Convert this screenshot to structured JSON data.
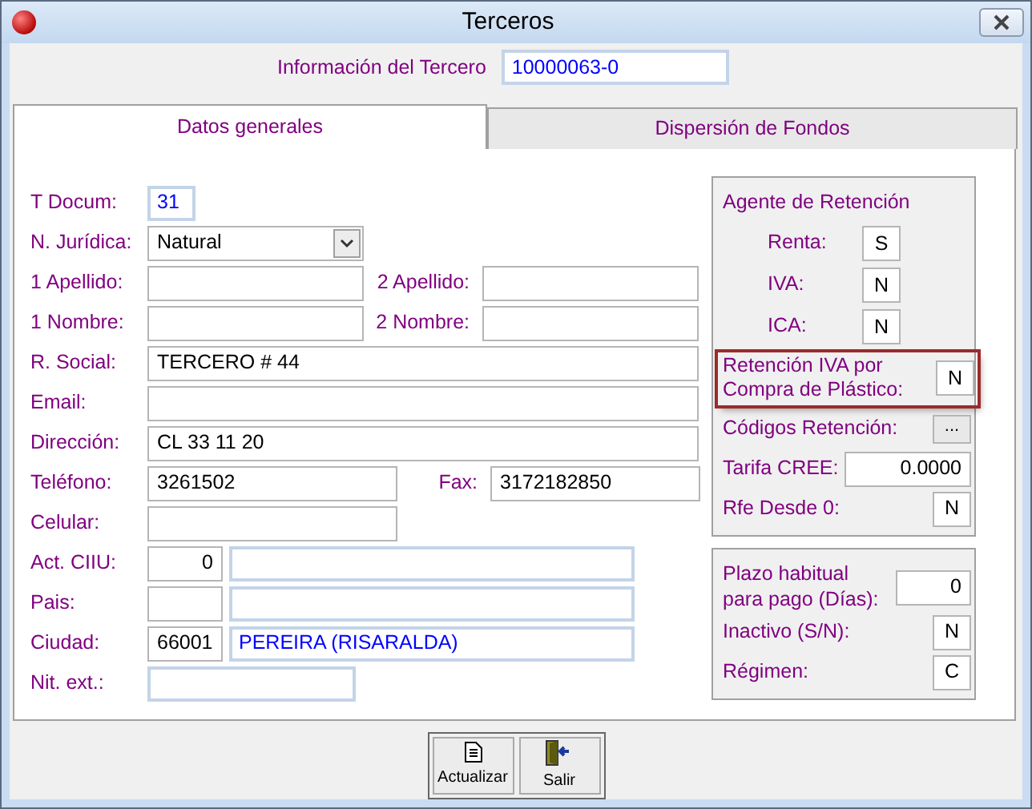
{
  "window": {
    "title": "Terceros"
  },
  "header": {
    "label": "Información del Tercero",
    "value": "10000063-0"
  },
  "tabs": [
    {
      "label": "Datos generales",
      "selected": true
    },
    {
      "label": "Dispersión de Fondos",
      "selected": false
    }
  ],
  "fields": [
    {
      "items": [
        {
          "kind": "label",
          "text": "T Docum:"
        },
        {
          "kind": "lookup",
          "value": "31"
        }
      ]
    },
    {
      "items": [
        {
          "kind": "label",
          "text": "N. Jurídica:"
        },
        {
          "kind": "select",
          "value": "Natural"
        }
      ]
    },
    {
      "items": [
        {
          "kind": "label",
          "text": "1 Apellido:"
        },
        {
          "kind": "text"
        },
        {
          "kind": "label",
          "text": "2 Apellido:"
        },
        {
          "kind": "text"
        }
      ]
    },
    {
      "items": [
        {
          "kind": "label",
          "text": "1 Nombre:"
        },
        {
          "kind": "text"
        },
        {
          "kind": "label",
          "text": "2 Nombre:"
        },
        {
          "kind": "text"
        }
      ]
    },
    {
      "items": [
        {
          "kind": "label",
          "text": "R. Social:"
        },
        {
          "kind": "text",
          "value": "TERCERO # 44"
        }
      ]
    },
    {
      "items": [
        {
          "kind": "label",
          "text": "Email:"
        },
        {
          "kind": "text"
        }
      ]
    },
    {
      "items": [
        {
          "kind": "label",
          "text": "Dirección:"
        },
        {
          "kind": "text",
          "value": "CL 33 11 20"
        }
      ]
    },
    {
      "items": [
        {
          "kind": "label",
          "text": "Teléfono:"
        },
        {
          "kind": "text",
          "value": "3261502"
        },
        {
          "kind": "label",
          "text": "Fax:"
        },
        {
          "kind": "text",
          "value": "3172182850"
        }
      ]
    },
    {
      "items": [
        {
          "kind": "label",
          "text": "Celular:"
        },
        {
          "kind": "text"
        }
      ]
    },
    {
      "items": [
        {
          "kind": "label",
          "text": "Act. CIIU:"
        },
        {
          "kind": "number",
          "value": "0"
        },
        {
          "kind": "lookup"
        }
      ]
    },
    {
      "items": [
        {
          "kind": "label",
          "text": "Pais:"
        },
        {
          "kind": "text"
        },
        {
          "kind": "lookup"
        }
      ]
    },
    {
      "items": [
        {
          "kind": "label",
          "text": "Ciudad:"
        },
        {
          "kind": "text",
          "value": "66001"
        },
        {
          "kind": "lookup",
          "value": "PEREIRA (RISARALDA)"
        }
      ]
    },
    {
      "items": [
        {
          "kind": "label",
          "text": "Nit. ext.:"
        },
        {
          "kind": "lookup"
        }
      ]
    }
  ],
  "agente_retencion": {
    "title": "Agente de Retención",
    "rows": [
      {
        "kind": "agent",
        "label": "Renta:",
        "value": "S"
      },
      {
        "kind": "agent",
        "label": "IVA:",
        "value": "N"
      },
      {
        "kind": "agent",
        "label": "ICA:",
        "value": "N"
      },
      {
        "kind": "flag",
        "label": "Retención IVA por Compra de Plástico:",
        "value": "N",
        "highlighted": true
      },
      {
        "kind": "button",
        "label": "Códigos Retención:",
        "value": "..."
      },
      {
        "kind": "number",
        "label": "Tarifa CREE:",
        "value": "0.0000"
      },
      {
        "kind": "flag",
        "label": "Rfe Desde 0:",
        "value": "N",
        "highlighted": false
      }
    ]
  },
  "condiciones": {
    "rows": [
      {
        "kind": "number",
        "label": "Plazo habitual para pago (Días):",
        "value": "0"
      },
      {
        "kind": "flag",
        "label": "Inactivo (S/N):",
        "value": "N",
        "highlighted": false
      },
      {
        "kind": "flag",
        "label": "Régimen:",
        "value": "C",
        "highlighted": false
      }
    ]
  },
  "buttons": [
    {
      "kind": "update",
      "label": "Actualizar"
    },
    {
      "kind": "exit",
      "label": "Salir"
    }
  ]
}
